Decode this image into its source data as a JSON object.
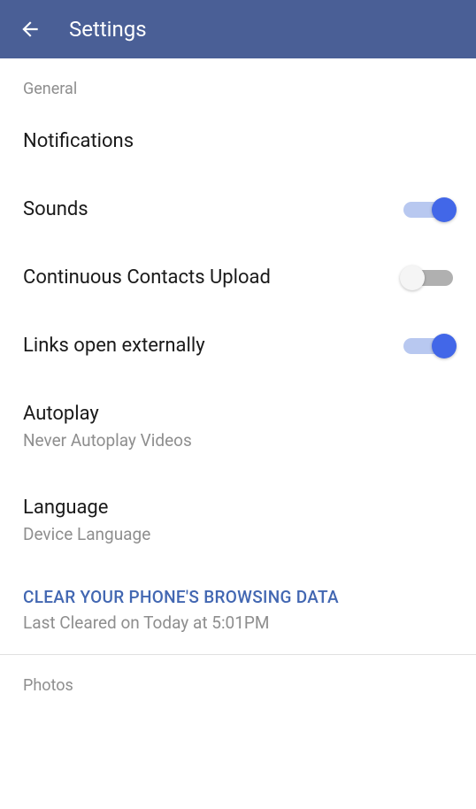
{
  "header": {
    "title": "Settings"
  },
  "sections": {
    "general": {
      "label": "General",
      "notifications": {
        "title": "Notifications"
      },
      "sounds": {
        "title": "Sounds",
        "enabled": true
      },
      "contacts_upload": {
        "title": "Continuous Contacts Upload",
        "enabled": false
      },
      "links_external": {
        "title": "Links open externally",
        "enabled": true
      },
      "autoplay": {
        "title": "Autoplay",
        "subtitle": "Never Autoplay Videos"
      },
      "language": {
        "title": "Language",
        "subtitle": "Device Language"
      },
      "clear_data": {
        "title": "CLEAR YOUR PHONE'S BROWSING DATA",
        "subtitle": "Last Cleared on Today at 5:01PM"
      }
    },
    "photos": {
      "label": "Photos"
    }
  }
}
